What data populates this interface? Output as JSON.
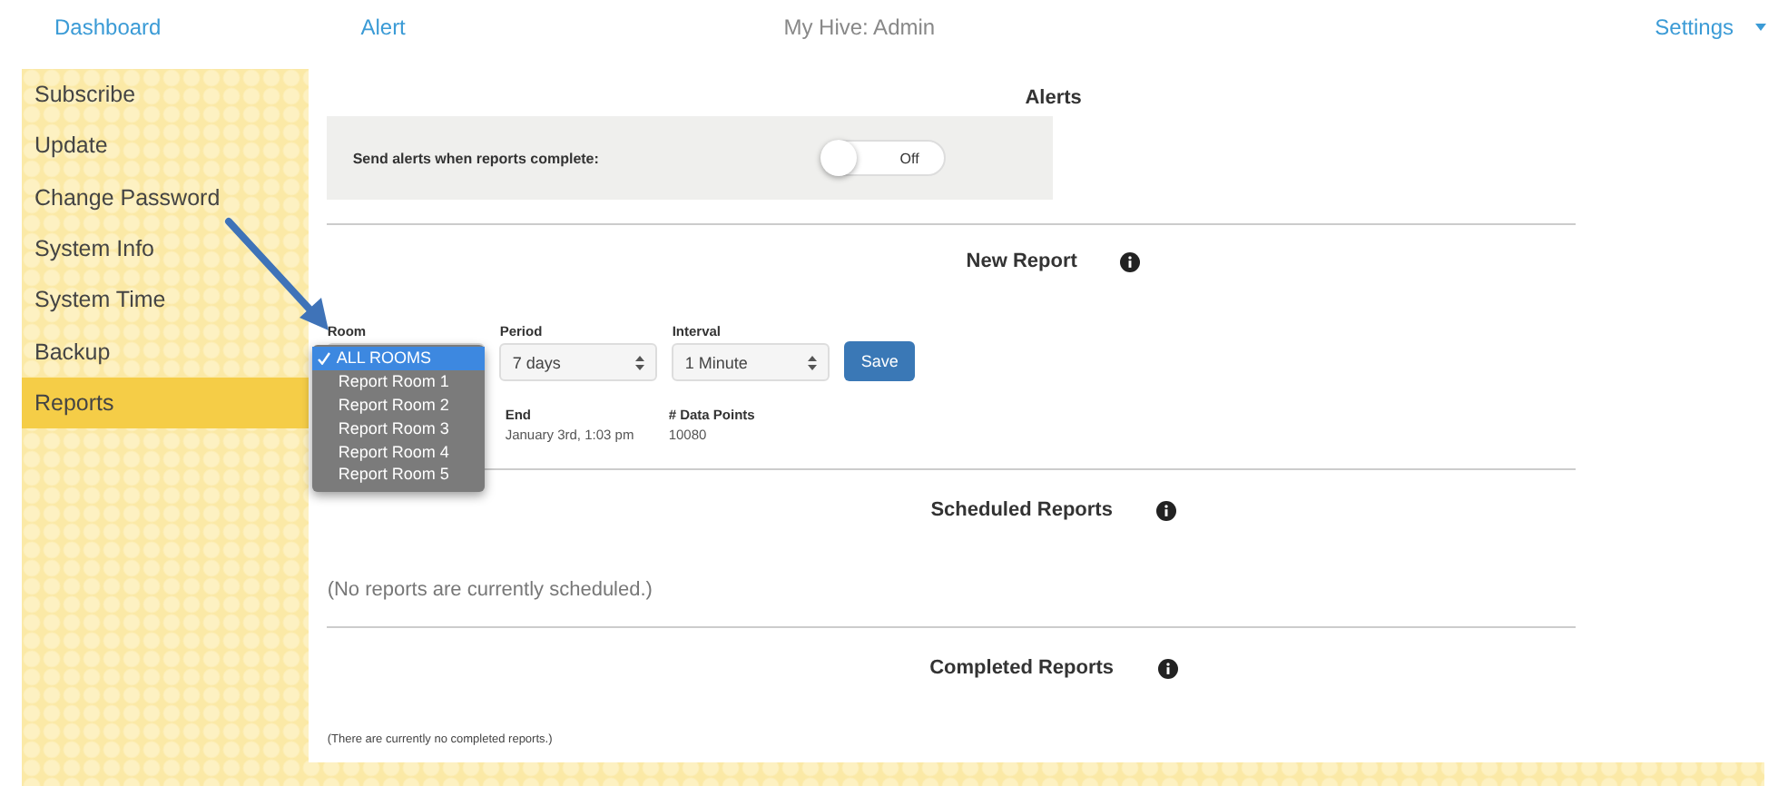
{
  "nav": {
    "links": [
      "Dashboard",
      "Alert"
    ],
    "title": "My Hive: Admin",
    "settings": "Settings"
  },
  "sidebar": {
    "items": [
      {
        "label": "Subscribe",
        "selected": false
      },
      {
        "label": "Update",
        "selected": false
      },
      {
        "label": "Change Password",
        "selected": false
      },
      {
        "label": "System Info",
        "selected": false
      },
      {
        "label": "System Time",
        "selected": false
      },
      {
        "label": "Backup",
        "selected": false
      },
      {
        "label": "Reports",
        "selected": true
      }
    ]
  },
  "alerts": {
    "title": "Alerts",
    "label": "Send alerts when reports complete:",
    "toggle": {
      "on": false,
      "label": "Off"
    }
  },
  "new_report": {
    "title": "New Report",
    "fields": [
      {
        "label": "Room",
        "kind": "open",
        "options": [
          {
            "label": "ALL ROOMS",
            "selected": true
          },
          {
            "label": "Report Room 1",
            "selected": false
          },
          {
            "label": "Report Room 2",
            "selected": false
          },
          {
            "label": "Report Room 3",
            "selected": false
          },
          {
            "label": "Report Room 4",
            "selected": false
          },
          {
            "label": "Report Room 5",
            "selected": false
          }
        ]
      },
      {
        "label": "Period",
        "kind": "select",
        "value": "7 days"
      },
      {
        "label": "Interval",
        "kind": "select",
        "value": "1 Minute"
      }
    ],
    "save": "Save",
    "summary": [
      {
        "label": "End",
        "value": "January 3rd, 1:03 pm"
      },
      {
        "label": "# Data Points",
        "value": "10080"
      }
    ]
  },
  "scheduled": {
    "title": "Scheduled Reports",
    "empty": "(No reports are currently scheduled.)"
  },
  "completed": {
    "title": "Completed Reports",
    "empty": "(There are currently no completed reports.)"
  }
}
